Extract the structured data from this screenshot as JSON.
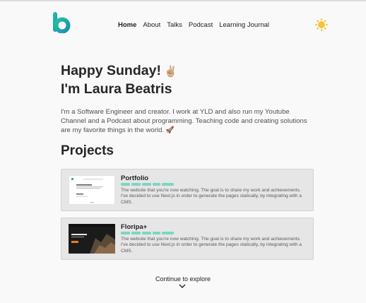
{
  "header": {
    "nav": [
      "Home",
      "About",
      "Talks",
      "Podcast",
      "Learning Journal"
    ]
  },
  "hero": {
    "greeting": "Happy Sunday!",
    "greeting_emoji": "✌🏼",
    "name": "I'm Laura Beatris",
    "bio": "I'm a Software Engineer and creator. I work at YLD and also run my Youtube Channel and a Podcast about programming. Teaching code and creating solutions are my favorite things in the world. 🚀"
  },
  "projects": {
    "title": "Projects",
    "items": [
      {
        "name": "Portfolio",
        "description": "The website that you're now watching. The goal is to share my work and achievements. I've decided to use Next.js in order to generate the pages statically, by integrating with a CMS."
      },
      {
        "name": "Floripa+",
        "description": "The website that you're now watching. The goal is to share my work and achievements. I've decided to use Next.js in order to generate the pages statically, by integrating with a CMS."
      }
    ]
  },
  "footer": {
    "continue": "Continue to explore"
  },
  "colors": {
    "accent": "#1fb39b",
    "tag": "#7ed6c0",
    "sun": "#f6c33b"
  }
}
